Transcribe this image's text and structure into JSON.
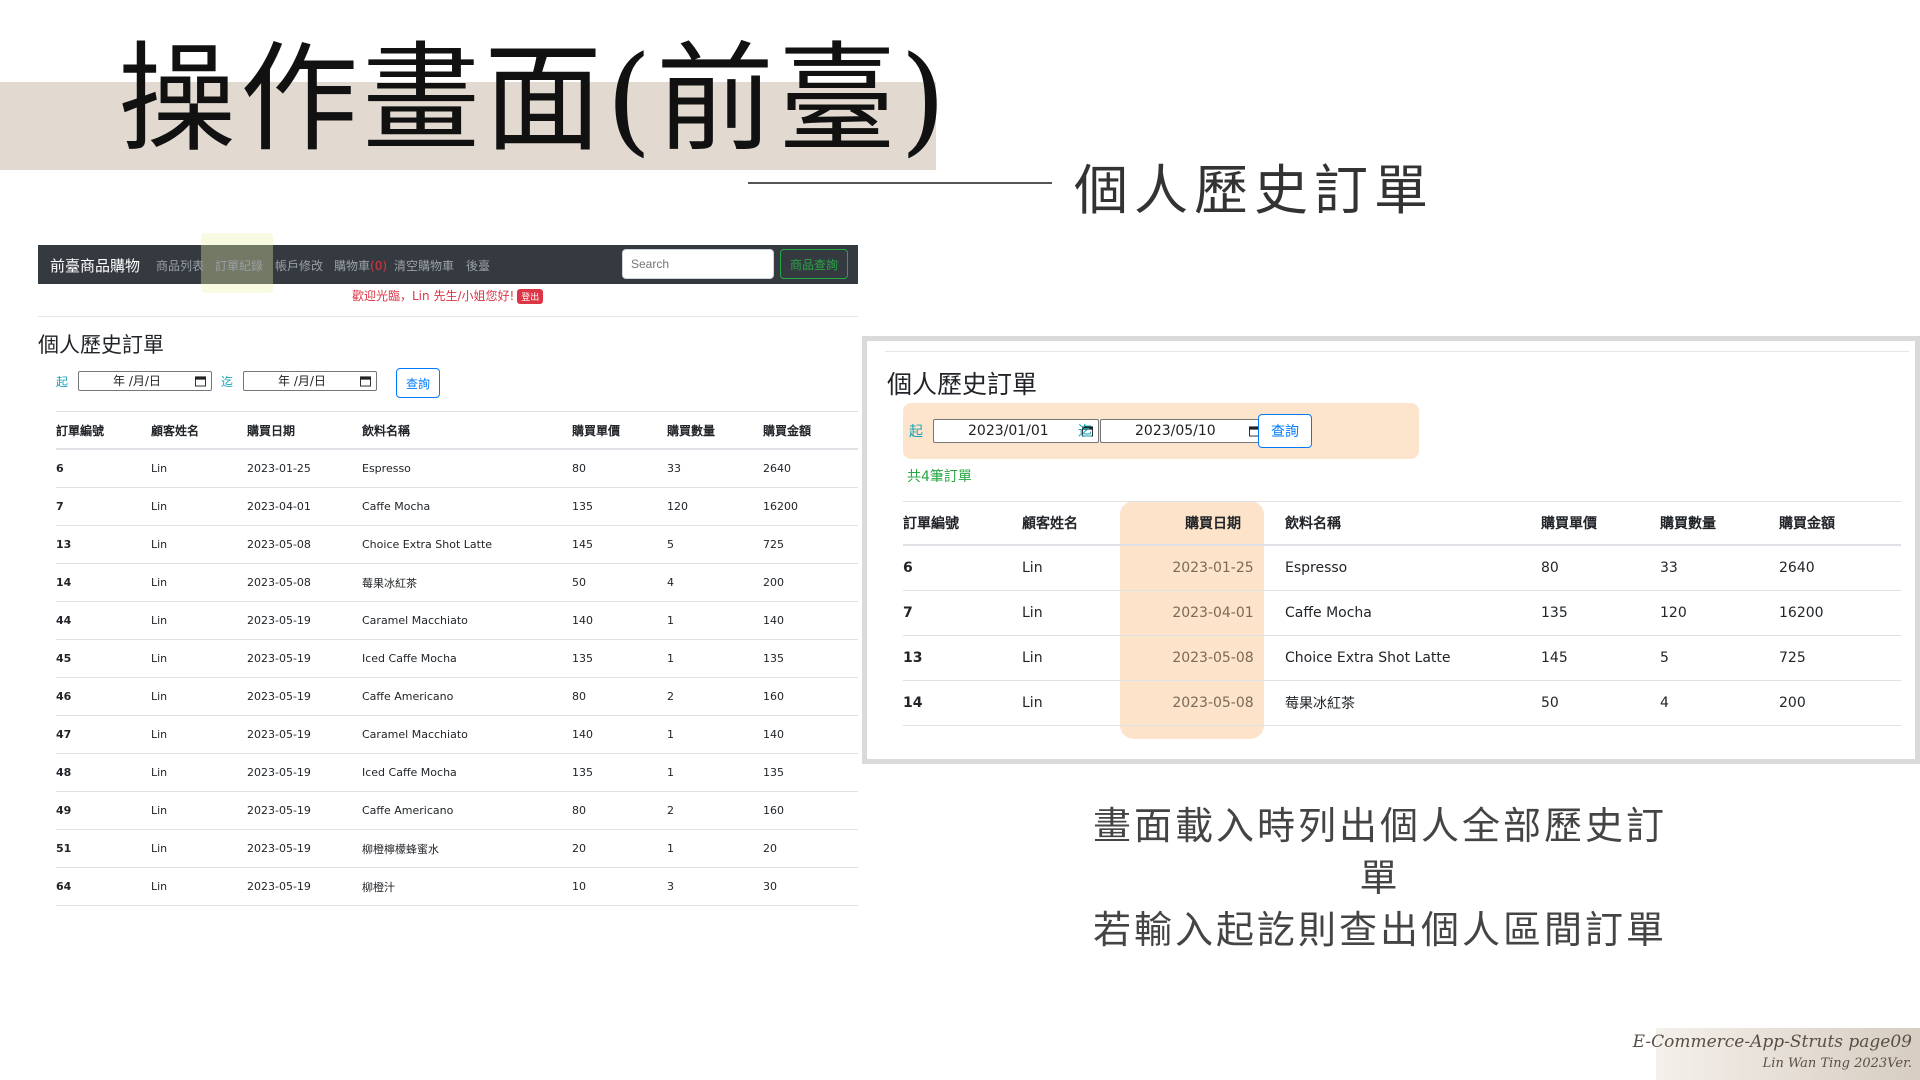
{
  "slide": {
    "title": "操作畫面(前臺)",
    "subtitle": "個人歷史訂單",
    "note_lines": [
      "畫面載入時列出個人全部歷史訂單",
      "若輸入起訖則查出個人區間訂單"
    ],
    "footer_line1": "E-Commerce-App-Struts page09",
    "footer_line2": "Lin Wan Ting 2023Ver."
  },
  "navbar": {
    "brand": "前臺商品購物",
    "items": [
      "商品列表",
      "訂單紀錄",
      "帳戶修改",
      "購物車",
      "清空購物車",
      "後臺"
    ],
    "cart_count": "(0)",
    "search_placeholder": "Search",
    "search_button": "商品查詢"
  },
  "welcome": {
    "text": "歡迎光臨，Lin 先生/小姐您好!",
    "logout": "登出"
  },
  "colors": {
    "navbar_bg": "#343a40",
    "accent_red": "#dc3545",
    "accent_blue": "#007bff",
    "accent_green": "#28a745",
    "highlight_peach": "#fce5cc"
  },
  "orders_page": {
    "heading": "個人歷史訂單",
    "from_label": "起",
    "to_label": "迄",
    "date_placeholder": "年 /月/日",
    "query_button": "查詢",
    "columns": [
      "訂單編號",
      "顧客姓名",
      "購買日期",
      "飲料名稱",
      "購買單價",
      "購買數量",
      "購買金額"
    ],
    "rows": [
      [
        "6",
        "Lin",
        "2023-01-25",
        "Espresso",
        "80",
        "33",
        "2640"
      ],
      [
        "7",
        "Lin",
        "2023-04-01",
        "Caffe Mocha",
        "135",
        "120",
        "16200"
      ],
      [
        "13",
        "Lin",
        "2023-05-08",
        "Choice Extra Shot Latte",
        "145",
        "5",
        "725"
      ],
      [
        "14",
        "Lin",
        "2023-05-08",
        "莓果冰紅茶",
        "50",
        "4",
        "200"
      ],
      [
        "44",
        "Lin",
        "2023-05-19",
        "Caramel Macchiato",
        "140",
        "1",
        "140"
      ],
      [
        "45",
        "Lin",
        "2023-05-19",
        "Iced Caffe Mocha",
        "135",
        "1",
        "135"
      ],
      [
        "46",
        "Lin",
        "2023-05-19",
        "Caffe Americano",
        "80",
        "2",
        "160"
      ],
      [
        "47",
        "Lin",
        "2023-05-19",
        "Caramel Macchiato",
        "140",
        "1",
        "140"
      ],
      [
        "48",
        "Lin",
        "2023-05-19",
        "Iced Caffe Mocha",
        "135",
        "1",
        "135"
      ],
      [
        "49",
        "Lin",
        "2023-05-19",
        "Caffe Americano",
        "80",
        "2",
        "160"
      ],
      [
        "51",
        "Lin",
        "2023-05-19",
        "柳橙檸檬蜂蜜水",
        "20",
        "1",
        "20"
      ],
      [
        "64",
        "Lin",
        "2023-05-19",
        "柳橙汁",
        "10",
        "3",
        "30"
      ]
    ]
  },
  "zoomed": {
    "heading": "個人歷史訂單",
    "from_label": "起",
    "to_label": "迄",
    "from_value": "2023/01/01",
    "to_value": "2023/05/10",
    "query_button": "查詢",
    "count_text": "共4筆訂單",
    "columns": [
      "訂單編號",
      "顧客姓名",
      "購買日期",
      "飲料名稱",
      "購買單價",
      "購買數量",
      "購買金額"
    ],
    "rows": [
      [
        "6",
        "Lin",
        "2023-01-25",
        "Espresso",
        "80",
        "33",
        "2640"
      ],
      [
        "7",
        "Lin",
        "2023-04-01",
        "Caffe Mocha",
        "135",
        "120",
        "16200"
      ],
      [
        "13",
        "Lin",
        "2023-05-08",
        "Choice Extra Shot Latte",
        "145",
        "5",
        "725"
      ],
      [
        "14",
        "Lin",
        "2023-05-08",
        "莓果冰紅茶",
        "50",
        "4",
        "200"
      ]
    ]
  }
}
